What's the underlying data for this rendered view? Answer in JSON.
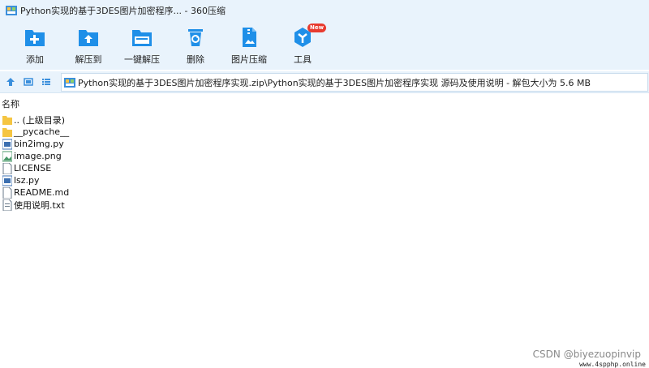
{
  "window": {
    "title": "Python实现的基于3DES图片加密程序... - 360压缩"
  },
  "toolbar": {
    "items": [
      {
        "label": "添加",
        "icon": "add-icon"
      },
      {
        "label": "解压到",
        "icon": "extract-to-icon"
      },
      {
        "label": "一键解压",
        "icon": "one-click-extract-icon"
      },
      {
        "label": "删除",
        "icon": "delete-icon"
      },
      {
        "label": "图片压缩",
        "icon": "image-compress-icon"
      },
      {
        "label": "工具",
        "icon": "tools-icon",
        "badge": "New"
      }
    ]
  },
  "address": {
    "path": "Python实现的基于3DES图片加密程序实现.zip\\Python实现的基于3DES图片加密程序实现 源码及使用说明 - 解包大小为 5.6 MB"
  },
  "list": {
    "column_name": "名称",
    "rows": [
      {
        "name": ".. (上级目录)",
        "type": "folder"
      },
      {
        "name": "__pycache__",
        "type": "folder"
      },
      {
        "name": "bin2img.py",
        "type": "python"
      },
      {
        "name": "image.png",
        "type": "image"
      },
      {
        "name": "LICENSE",
        "type": "file"
      },
      {
        "name": "lsz.py",
        "type": "python"
      },
      {
        "name": "README.md",
        "type": "file"
      },
      {
        "name": "使用说明.txt",
        "type": "file"
      }
    ]
  },
  "watermark": {
    "csdn": "CSDN @biyezuopinvip",
    "site": "www.4spphp.online"
  },
  "colors": {
    "accent": "#1f8fe8",
    "toolbar_bg": "#e9f3fc",
    "badge": "#e83b2f",
    "folder": "#f5c542"
  }
}
